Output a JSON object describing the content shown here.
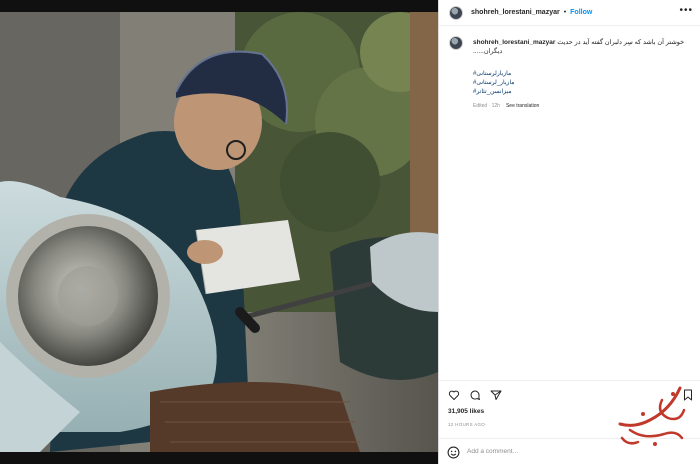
{
  "header": {
    "username": "shohreh_lorestani_mazyar",
    "separator": "•",
    "follow_label": "Follow",
    "more_icon": "more-horizontal-icon"
  },
  "caption": {
    "username": "shohreh_lorestani_mazyar",
    "text": "خوشتر آن باشد که سِر دلبران گفته آید در حدیث دیگران......",
    "hashtags": [
      "#مازیارلرستانی",
      "#مازیار_لرستانی",
      "#میزانسن_تئاتر"
    ],
    "edited": "Edited · 12h",
    "see_translation": "See translation"
  },
  "actions": {
    "like_icon": "heart-icon",
    "comment_icon": "comment-icon",
    "share_icon": "paper-plane-icon",
    "save_icon": "bookmark-icon"
  },
  "likes": "31,905 likes",
  "time_ago": "12 HOURS AGO",
  "comment_box": {
    "emoji_icon": "emoji-icon",
    "placeholder": "Add a comment…"
  },
  "colors": {
    "follow_blue": "#0095f6",
    "hashtag_link": "#00376b",
    "muted_text": "#8e8e8e",
    "watermark_red": "#c0392b"
  }
}
